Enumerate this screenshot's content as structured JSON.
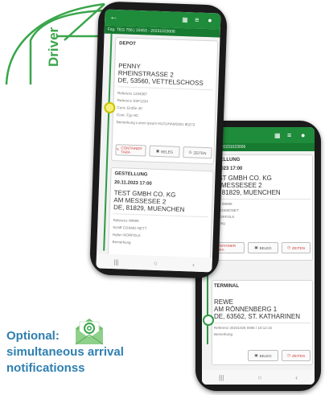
{
  "banner": {
    "label": "Driver",
    "color": "#3aa64b"
  },
  "phone_left": {
    "header_text": "Fzg. TEG 756 | 10453 - 20231023006",
    "depot": {
      "title": "DEPOT",
      "lines": [
        "PENNY",
        "RHEINSTRASSE 2",
        "DE, 53560, VETTELSCHOSS"
      ],
      "fields": [
        {
          "label": "Referenz",
          "value": "1234567"
        },
        {
          "label": "Referenz",
          "value": "SSF1234"
        },
        {
          "label": "Cont.-Größe",
          "value": "40"
        },
        {
          "label": "Cont.-Typ",
          "value": "HC"
        },
        {
          "label": "Bemerkung",
          "value": "Lorem ipsum HLCUHAM2301 85273"
        }
      ],
      "buttons": {
        "b1": "CONTAINER TARA",
        "b2": "BELEG",
        "b3": "ZEITEN"
      }
    },
    "gestellung": {
      "title": "GESTELLUNG",
      "date": "20.11.2023 17:00",
      "lines": [
        "TEST GMBH CO. KG",
        "AM MESSESEE 2",
        "DE, 81829, MUENCHEN"
      ],
      "fields": [
        {
          "label": "Referenz",
          "value": "99999"
        },
        {
          "label": "Schiff",
          "value": "COSMO NETT"
        },
        {
          "label": "Hafen",
          "value": "NORFOLK"
        },
        {
          "label": "Bemerkung",
          "value": ""
        }
      ]
    }
  },
  "phone_right": {
    "header_text": "ahrt 88 | 20231023006",
    "gestellung": {
      "title": "STELLUNG",
      "date": "1.2023 17:00",
      "lines": [
        "EST GMBH CO. KG",
        "M MESSESEE 2",
        "E, 81829, MUENCHEN"
      ],
      "fields": [
        "renz 99999",
        "iff COSMONET",
        "n NORFOLK",
        "erkung"
      ],
      "buttons": {
        "b1": "CONTAINER TARA",
        "b2": "BELEG",
        "b3": "ZEITEN"
      }
    },
    "terminal": {
      "title": "TERMINAL",
      "lines": [
        "REWE",
        "AM RÖNNENBERG 1",
        "DE, 63562, ST. KATHARINEN"
      ],
      "fields": [
        "Referenz 20231026 0065 / 18:12:15",
        "Bemerkung"
      ],
      "buttons": {
        "b2": "BELEG",
        "b3": "ZEITEN"
      }
    }
  },
  "footer": {
    "optional": "Optional:",
    "line2": "simultaneous arrival",
    "line3": "notificationss",
    "icon": "email-at-icon",
    "color": "#2f7fb0"
  }
}
